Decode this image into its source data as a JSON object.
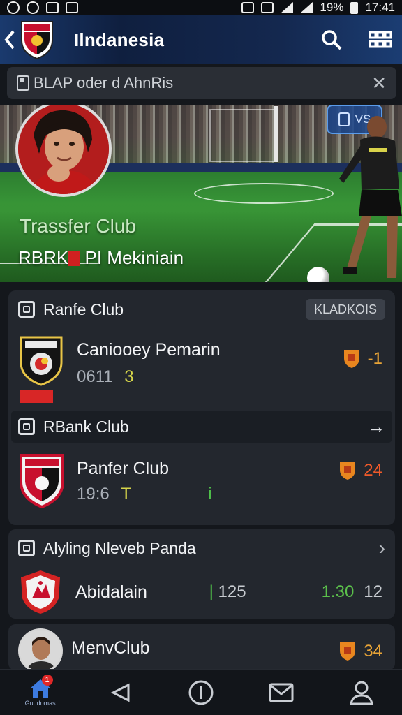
{
  "status_bar": {
    "battery": "19%",
    "time": "17:41"
  },
  "header": {
    "title": "Ilndanesia"
  },
  "notice": {
    "text": "BLAP oder d AhnRis"
  },
  "hero": {
    "title": "Trassfer Club",
    "subtitle_prefix": "RBRK",
    "subtitle_mid": "PI",
    "subtitle_name": "Mekiniain",
    "vs_label": "VS"
  },
  "cards": {
    "ranfe": {
      "title": "Ranfe Club",
      "action": "KLADKOIS",
      "name": "Caniooey Pemarin",
      "sub_value": "0611",
      "sub_accent": "3",
      "right_value": "-1"
    },
    "rbank": {
      "title": "RBank Club",
      "name": "Panfer Club",
      "sub_value": "19:6",
      "sub_accent": "T",
      "sub_accent2": "i",
      "right_value": "24"
    },
    "alyling": {
      "title": "Alyling Nleveb Panda",
      "name": "Abidalain",
      "value_a": "125",
      "value_b": "1.30",
      "value_c": "12"
    },
    "menv": {
      "name": "MenvClub",
      "right_value": "34"
    }
  },
  "bottom_nav": {
    "home_label": "Guudomas",
    "home_badge": "1"
  },
  "colors": {
    "accent_orange": "#e8a437",
    "accent_red": "#ef5a2a",
    "accent_green": "#5bc04b",
    "header_blue": "#1a3a6e"
  }
}
